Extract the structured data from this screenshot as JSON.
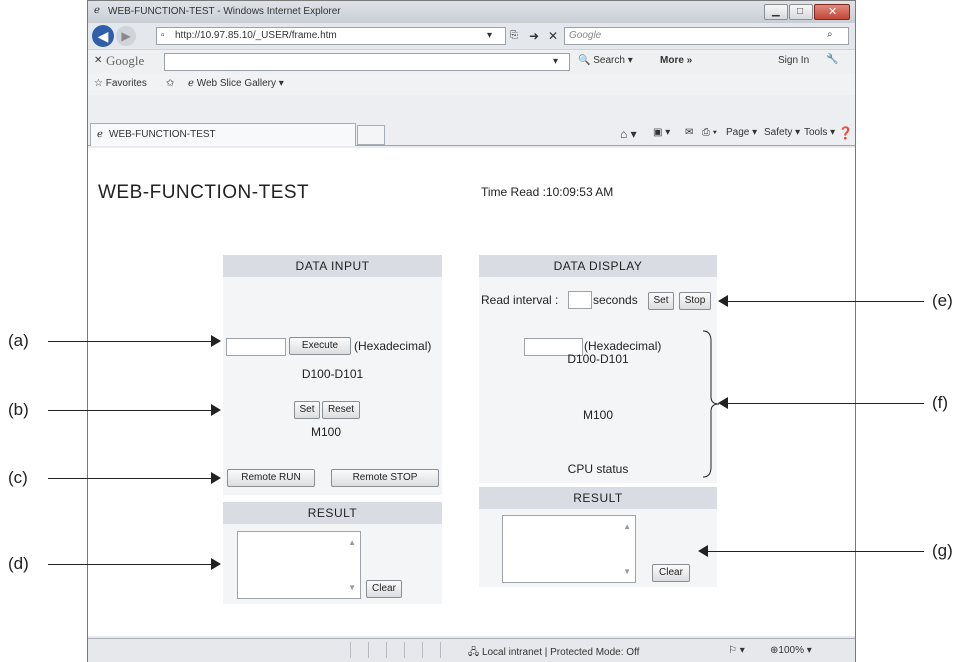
{
  "browser": {
    "window_title": "WEB-FUNCTION-TEST - Windows Internet Explorer",
    "address": "http://10.97.85.10/_USER/frame.htm",
    "search_placeholder": "Google",
    "google_bar": {
      "logo": "Google",
      "search_label": "Search",
      "more_label": "More »",
      "signin_label": "Sign In"
    },
    "favorites": {
      "favorites_label": "Favorites",
      "web_slice_label": "Web Slice Gallery"
    },
    "tab_title": "WEB-FUNCTION-TEST",
    "command_bar": {
      "page_label": "Page",
      "safety_label": "Safety",
      "tools_label": "Tools"
    },
    "status": {
      "zone": "Local intranet | Protected Mode: Off",
      "zoom": "100%"
    }
  },
  "page": {
    "title": "WEB-FUNCTION-TEST",
    "time_read": "Time Read :10:09:53 AM",
    "data_input": {
      "header": "DATA INPUT",
      "input_value": "",
      "execute_label": "Execute",
      "hex_label": "(Hexadecimal)",
      "device_label": "D100-D101",
      "set_label": "Set",
      "reset_label": "Reset",
      "bit_device": "M100",
      "remote_run_label": "Remote RUN",
      "remote_stop_label": "Remote STOP",
      "result_header": "RESULT",
      "clear_label": "Clear"
    },
    "data_display": {
      "header": "DATA DISPLAY",
      "read_interval_label": "Read interval :",
      "interval_value": "",
      "seconds_label": "seconds",
      "set_label": "Set",
      "stop_label": "Stop",
      "value": "",
      "hex_label": "(Hexadecimal)",
      "device_label": "D100-D101",
      "bit_device": "M100",
      "cpu_status_label": "CPU status",
      "result_header": "RESULT",
      "clear_label": "Clear"
    }
  },
  "callouts": {
    "a": "(a)",
    "b": "(b)",
    "c": "(c)",
    "d": "(d)",
    "e": "(e)",
    "f": "(f)",
    "g": "(g)"
  }
}
